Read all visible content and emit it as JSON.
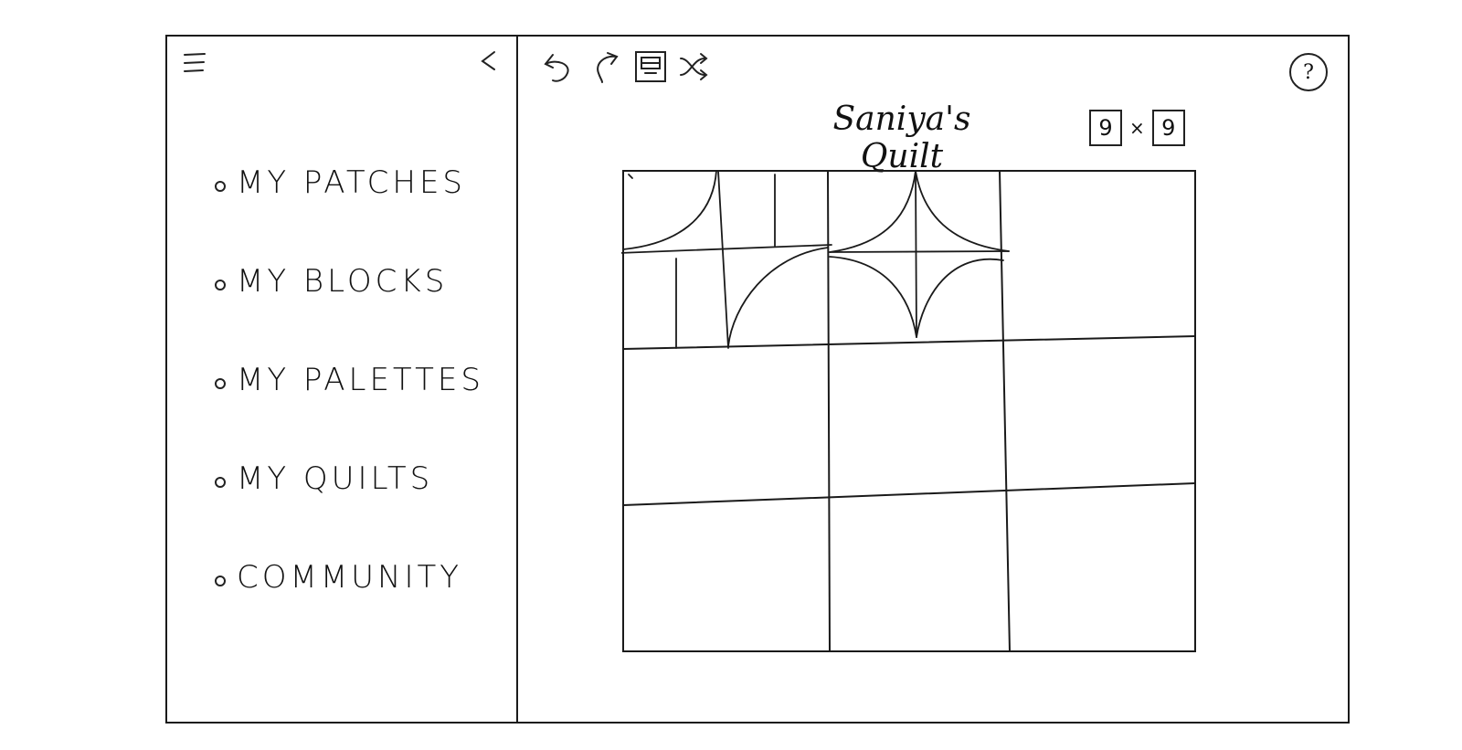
{
  "sidebar": {
    "menu_icon": "hamburger-icon",
    "collapse_icon": "chevron-left-icon",
    "items": [
      {
        "label": "MY PATCHES"
      },
      {
        "label": "MY BLOCKS"
      },
      {
        "label": "MY PALETTES"
      },
      {
        "label": "MY QUILTS"
      },
      {
        "label": "COMMUNITY"
      }
    ]
  },
  "toolbar": {
    "tools": [
      "undo-icon",
      "redo-icon",
      "save-icon",
      "shuffle-icon"
    ]
  },
  "help_label": "?",
  "quilt": {
    "title": "Saniya's Quilt",
    "rows": "9",
    "cols": "9",
    "separator": "×"
  },
  "grid": {
    "rows": 3,
    "cols": 3
  }
}
